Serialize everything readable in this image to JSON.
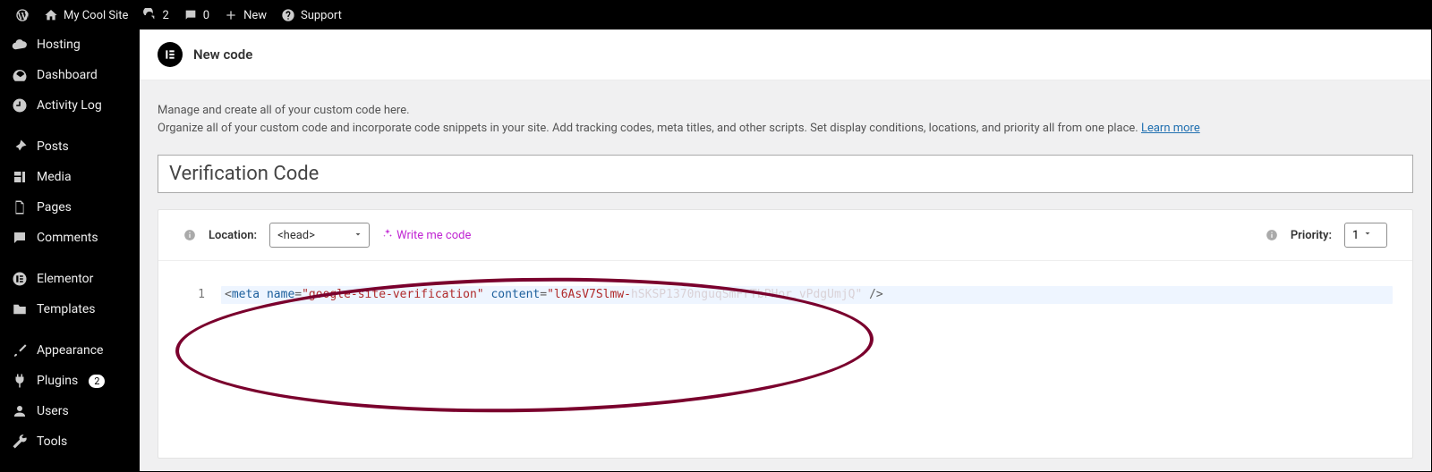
{
  "adminbar": {
    "site_name": "My Cool Site",
    "updates_count": "2",
    "comments_count": "0",
    "new_label": "New",
    "support_label": "Support"
  },
  "sidebar": {
    "items": [
      {
        "label": "Hosting",
        "icon": "cloud"
      },
      {
        "label": "Dashboard",
        "icon": "gauge"
      },
      {
        "label": "Activity Log",
        "icon": "clock"
      },
      {
        "label": "Posts",
        "icon": "pin"
      },
      {
        "label": "Media",
        "icon": "media"
      },
      {
        "label": "Pages",
        "icon": "page"
      },
      {
        "label": "Comments",
        "icon": "chat"
      },
      {
        "label": "Elementor",
        "icon": "ecircle"
      },
      {
        "label": "Templates",
        "icon": "folder"
      },
      {
        "label": "Appearance",
        "icon": "brush"
      },
      {
        "label": "Plugins",
        "icon": "plug",
        "badge": "2"
      },
      {
        "label": "Users",
        "icon": "user"
      },
      {
        "label": "Tools",
        "icon": "wrench"
      }
    ]
  },
  "header": {
    "title": "New code"
  },
  "intro": {
    "line1": "Manage and create all of your custom code here.",
    "line2": "Organize all of your custom code and incorporate code snippets in your site. Add tracking codes, meta titles, and other scripts. Set display conditions, locations, and priority all from one place. ",
    "learn_more": "Learn more"
  },
  "title_field": {
    "value": "Verification Code"
  },
  "toolbar": {
    "location_label": "Location:",
    "location_value": "<head>",
    "write_me": "Write me code",
    "priority_label": "Priority:",
    "priority_value": "1"
  },
  "editor": {
    "line_no": "1",
    "code": {
      "t1": "<",
      "t2": "meta",
      "t3": " ",
      "t4": "name",
      "t5": "=",
      "t6": "\"google-site-verification\"",
      "t7": " ",
      "t8": "content",
      "t9": "=",
      "t10": "\"l6AsV7Slmw-",
      "t11": "hSKSP1370nguqSmFrTbPHor_vPdgUmjQ\"",
      "t12": " />"
    }
  }
}
